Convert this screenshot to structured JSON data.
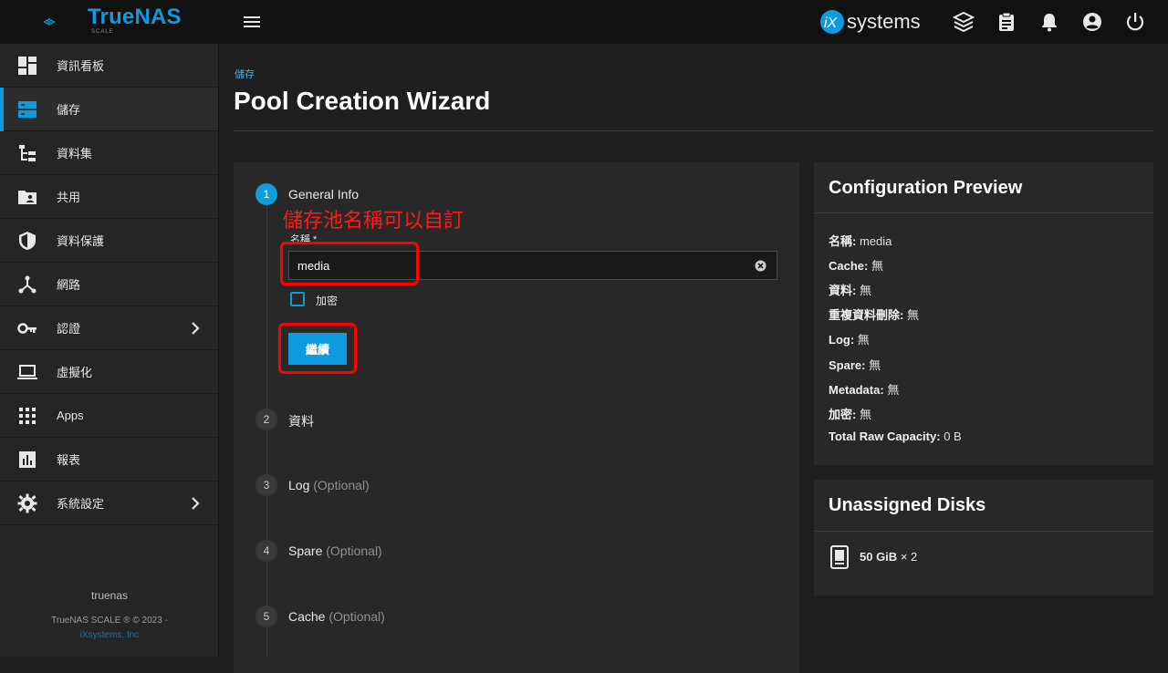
{
  "brand": {
    "name": "TrueNAS",
    "sub": "SCALE",
    "vendor": "systems",
    "accent": "#0f9be0"
  },
  "sidebar": {
    "items": [
      {
        "label": "資訊看板",
        "icon": "dashboard-icon"
      },
      {
        "label": "儲存",
        "icon": "storage-icon",
        "active": true
      },
      {
        "label": "資料集",
        "icon": "datasets-icon"
      },
      {
        "label": "共用",
        "icon": "shares-icon"
      },
      {
        "label": "資料保護",
        "icon": "shield-icon"
      },
      {
        "label": "網路",
        "icon": "network-icon"
      },
      {
        "label": "認證",
        "icon": "key-icon",
        "chevron": true
      },
      {
        "label": "虛擬化",
        "icon": "laptop-icon"
      },
      {
        "label": "Apps",
        "icon": "apps-icon"
      },
      {
        "label": "報表",
        "icon": "reports-icon"
      },
      {
        "label": "系統設定",
        "icon": "gear-icon",
        "chevron": true
      }
    ],
    "hostname": "truenas",
    "copyright": "TrueNAS SCALE ® © 2023 -",
    "company": "iXsystems, Inc"
  },
  "main": {
    "breadcrumb": "儲存",
    "title": "Pool Creation Wizard"
  },
  "wizard": {
    "annotation": "儲存池名稱可以自訂",
    "steps": [
      {
        "num": "1",
        "title": "General Info",
        "optional": ""
      },
      {
        "num": "2",
        "title": "資料",
        "optional": ""
      },
      {
        "num": "3",
        "title": "Log",
        "optional": "(Optional)"
      },
      {
        "num": "4",
        "title": "Spare",
        "optional": "(Optional)"
      },
      {
        "num": "5",
        "title": "Cache",
        "optional": "(Optional)"
      }
    ],
    "name_label": "名稱 *",
    "name_value": "media",
    "encrypt_label": "加密",
    "continue_label": "繼續"
  },
  "preview": {
    "title": "Configuration Preview",
    "rows": [
      {
        "key": "名稱:",
        "value": "media"
      },
      {
        "key": "Cache:",
        "value": "無"
      },
      {
        "key": "資料:",
        "value": "無"
      },
      {
        "key": "重複資料刪除:",
        "value": "無"
      },
      {
        "key": "Log:",
        "value": "無"
      },
      {
        "key": "Spare:",
        "value": "無"
      },
      {
        "key": "Metadata:",
        "value": "無"
      },
      {
        "key": "加密:",
        "value": "無"
      },
      {
        "key": "Total Raw Capacity:",
        "value": "0 B"
      }
    ]
  },
  "unassigned": {
    "title": "Unassigned Disks",
    "disk_size": "50 GiB",
    "disk_count": "× 2"
  }
}
